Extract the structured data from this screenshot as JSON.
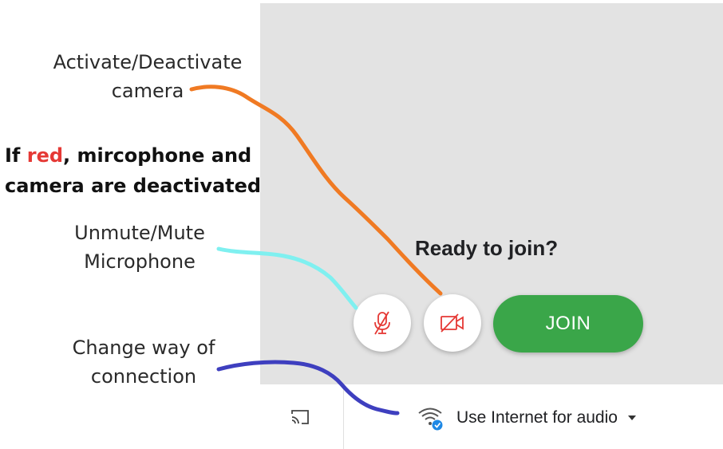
{
  "annotations": {
    "camera_line1": "Activate/Deactivate",
    "camera_line2": "camera",
    "red_prefix": "If ",
    "red_word": "red",
    "red_line1_rest": ", mircophone and",
    "red_line2": "camera are deactivated",
    "mic_line1": "Unmute/Mute",
    "mic_line2": "Microphone",
    "conn_line1": "Change way of",
    "conn_line2": "connection"
  },
  "meeting": {
    "ready_text": "Ready to join?",
    "join_label": "JOIN",
    "audio_label": "Use Internet for audio"
  },
  "icons": {
    "mic": "mic-off-icon",
    "camera": "camera-off-icon",
    "cast": "cast-icon",
    "wifi": "wifi-check-icon",
    "caret": "caret-down-icon"
  },
  "colors": {
    "join_green": "#3aa649",
    "off_red": "#e53935",
    "preview_bg": "#e3e3e3",
    "camera_arrow": "#f07a23",
    "mic_arrow": "#7ff0f0",
    "connection_arrow": "#3e3fbf"
  }
}
